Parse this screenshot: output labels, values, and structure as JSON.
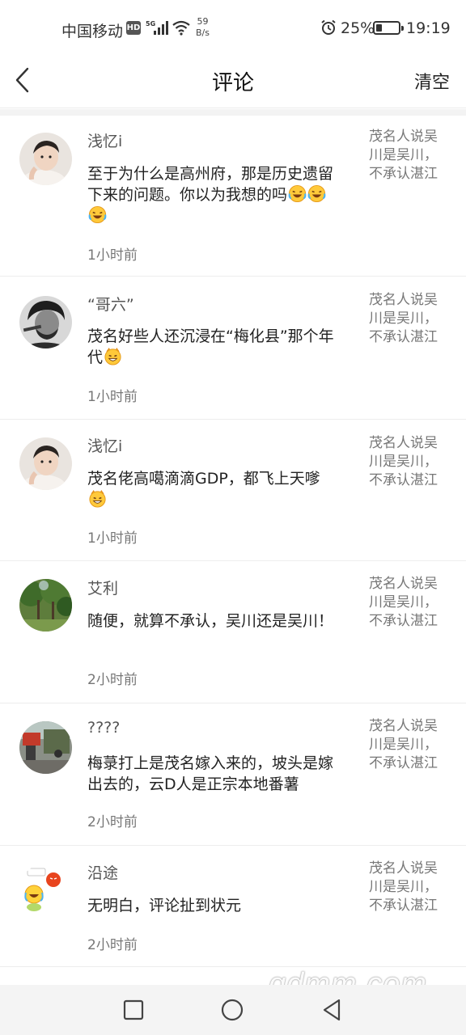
{
  "status_bar": {
    "carrier": "中国移动",
    "hd_badge": "HD",
    "network": "5G",
    "speed_value": "59",
    "speed_unit": "B/s",
    "battery_percent": "25%",
    "time": "19:19",
    "icons": [
      "hd-icon",
      "signal-icon",
      "wifi-icon",
      "alarm-icon",
      "battery-icon"
    ]
  },
  "nav": {
    "title": "评论",
    "clear_label": "清空",
    "back_icon": "chevron-left-icon"
  },
  "comments": [
    {
      "username": "浅忆i",
      "content": "至于为什么是高州府，那是历史遗留下来的问题。你以为我想的吗",
      "emojis": [
        "laugh-cry",
        "laugh-cry",
        "laugh-cry"
      ],
      "time": "1小时前",
      "quote": "茂名人说吴川是吴川，不承认湛江",
      "avatar": "toddler-photo"
    },
    {
      "username": "“哥六”",
      "content": "茂名好些人还沉浸在“梅化县”那个年代",
      "emojis": [
        "grin-face"
      ],
      "time": "1小时前",
      "quote": "茂名人说吴川是吴川，不承认湛江",
      "avatar": "man-cigar-photo"
    },
    {
      "username": "浅忆i",
      "content": "茂名佬高噶滴滴GDP，都飞上天嗲",
      "emojis": [
        "grin-face"
      ],
      "time": "1小时前",
      "quote": "茂名人说吴川是吴川，不承认湛江",
      "avatar": "toddler-photo"
    },
    {
      "username": "艾利",
      "content": "随便，就算不承认，吴川还是吴川！",
      "emojis": [],
      "time": "2小时前",
      "quote": "茂名人说吴川是吴川，不承认湛江",
      "avatar": "trees-photo"
    },
    {
      "username": "????",
      "content": "梅菉打上是茂名嫁入来的，坡头是嫁出去的，云D人是正宗本地番薯",
      "emojis": [],
      "time": "2小时前",
      "quote": "茂名人说吴川是吴川，不承认湛江",
      "avatar": "street-photo"
    },
    {
      "username": "沿途",
      "content": "无明白，评论扯到状元",
      "emojis": [],
      "time": "2小时前",
      "quote": "茂名人说吴川是吴川，不承认湛江",
      "avatar": "sticker-image"
    }
  ],
  "bottom_nav": {
    "icons": [
      "square-recent-icon",
      "circle-home-icon",
      "triangle-back-icon"
    ]
  },
  "watermark": "gdmm.com",
  "colors": {
    "text_primary": "#222222",
    "text_secondary": "#777777",
    "divider": "#ededed"
  }
}
